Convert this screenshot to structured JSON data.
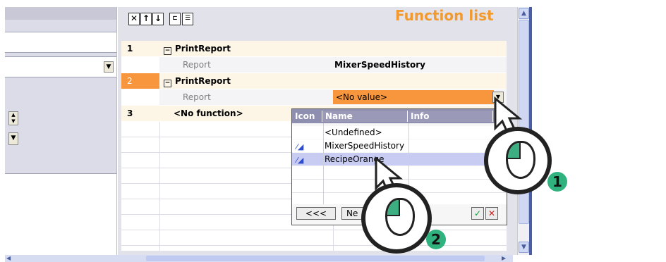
{
  "title": "Function list",
  "rows": [
    {
      "num": "1",
      "function": "PrintReport",
      "param_label": "Report",
      "param_value": "MixerSpeedHistory"
    },
    {
      "num": "2",
      "function": "PrintReport",
      "param_label": "Report",
      "param_value": "<No value>"
    },
    {
      "num": "3",
      "function": "<No function>"
    }
  ],
  "popup": {
    "columns": {
      "icon": "Icon",
      "name": "Name",
      "info": "Info"
    },
    "items": [
      {
        "name": "<Undefined>",
        "icon": ""
      },
      {
        "name": "MixerSpeedHistory",
        "icon": "script-icon"
      },
      {
        "name": "RecipeOrange",
        "icon": "script-icon"
      }
    ],
    "back_button": "<<<",
    "next_button": "Ne"
  },
  "callouts": {
    "first": "1",
    "second": "2"
  },
  "colors": {
    "accent": "#f29a2e",
    "selected_value_bg": "#f7963c",
    "header_bg": "#8e8eb0",
    "highlight_row": "#c9ccf2"
  }
}
